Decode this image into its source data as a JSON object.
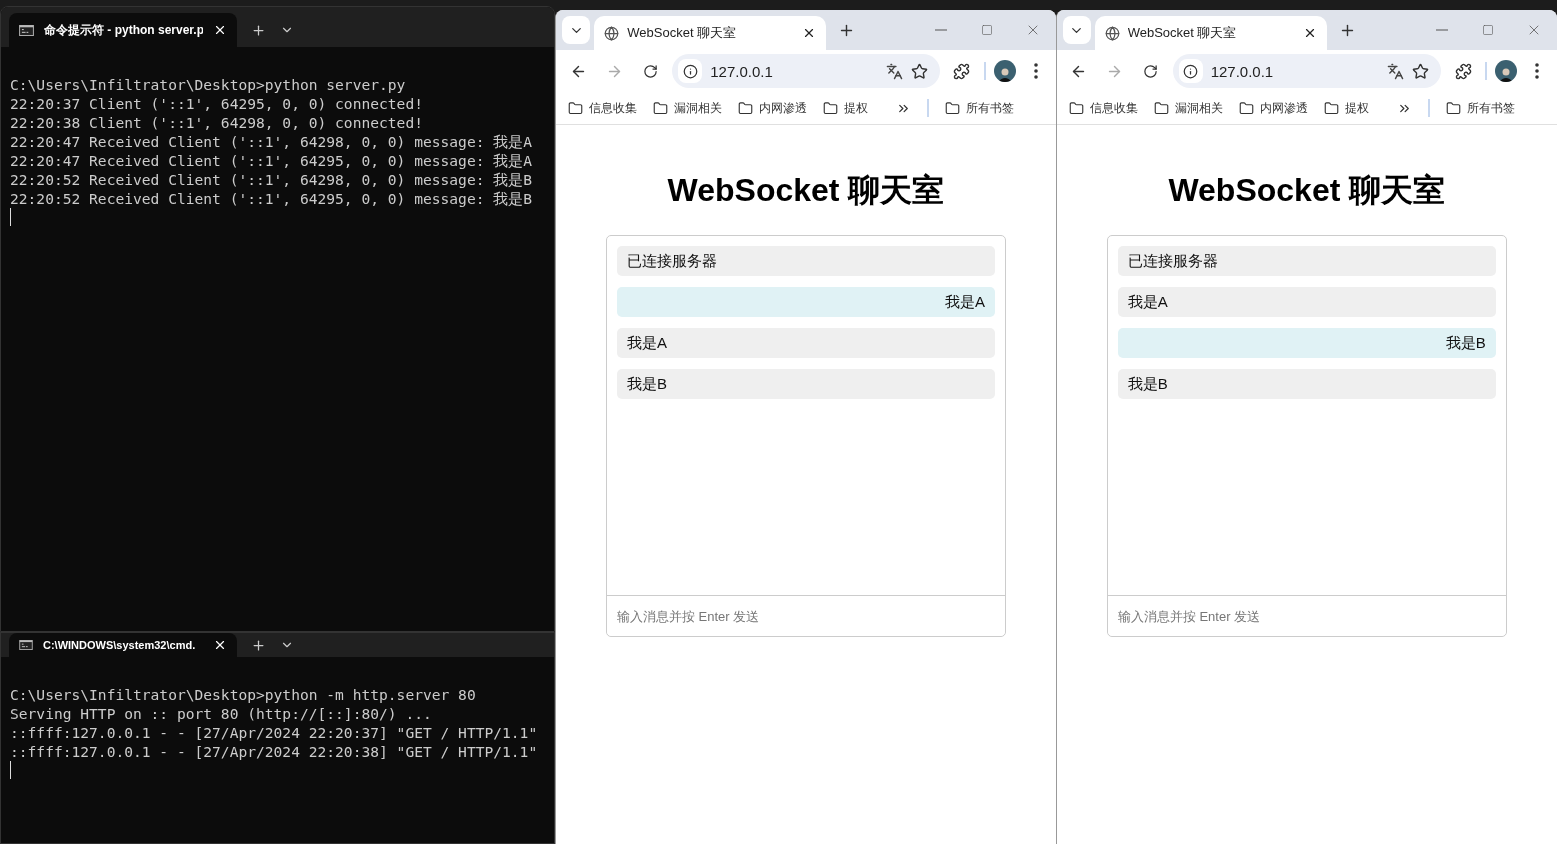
{
  "terminals": [
    {
      "tab_title": "命令提示符 - python  server.p",
      "lines": [
        "C:\\Users\\Infiltrator\\Desktop>python server.py",
        "22:20:37 Client ('::1', 64295, 0, 0) connected!",
        "22:20:38 Client ('::1', 64298, 0, 0) connected!",
        "22:20:47 Received Client ('::1', 64298, 0, 0) message: 我是A",
        "22:20:47 Received Client ('::1', 64295, 0, 0) message: 我是A",
        "22:20:52 Received Client ('::1', 64298, 0, 0) message: 我是B",
        "22:20:52 Received Client ('::1', 64295, 0, 0) message: 我是B"
      ]
    },
    {
      "tab_title": "C:\\WINDOWS\\system32\\cmd.",
      "lines": [
        "C:\\Users\\Infiltrator\\Desktop>python -m http.server 80",
        "Serving HTTP on :: port 80 (http://[::]:80/) ...",
        "::ffff:127.0.0.1 - - [27/Apr/2024 22:20:37] \"GET / HTTP/1.1\"",
        "::ffff:127.0.0.1 - - [27/Apr/2024 22:20:38] \"GET / HTTP/1.1\""
      ]
    }
  ],
  "browsers": [
    {
      "tab_title": "WebSocket 聊天室",
      "url": "127.0.0.1",
      "forward_disabled": true,
      "bookmarks": [
        "信息收集",
        "漏洞相关",
        "内网渗透",
        "提权"
      ],
      "all_bookmarks": "所有书签",
      "page": {
        "heading": "WebSocket 聊天室",
        "messages": [
          {
            "text": "已连接服务器",
            "kind": "received"
          },
          {
            "text": "我是A",
            "kind": "own"
          },
          {
            "text": "我是A",
            "kind": "received"
          },
          {
            "text": "我是B",
            "kind": "received"
          }
        ],
        "input": {
          "placeholder": "输入消息并按 Enter 发送"
        }
      }
    },
    {
      "tab_title": "WebSocket 聊天室",
      "url": "127.0.0.1",
      "forward_disabled": true,
      "bookmarks": [
        "信息收集",
        "漏洞相关",
        "内网渗透",
        "提权"
      ],
      "all_bookmarks": "所有书签",
      "page": {
        "heading": "WebSocket 聊天室",
        "messages": [
          {
            "text": "已连接服务器",
            "kind": "received"
          },
          {
            "text": "我是A",
            "kind": "received"
          },
          {
            "text": "我是B",
            "kind": "own"
          },
          {
            "text": "我是B",
            "kind": "received"
          }
        ],
        "input": {
          "placeholder": "输入消息并按 Enter 发送"
        }
      }
    }
  ]
}
